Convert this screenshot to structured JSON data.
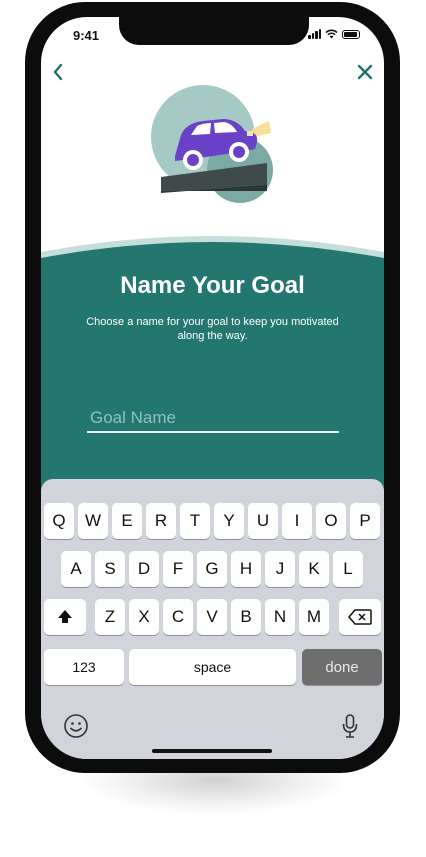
{
  "status_bar": {
    "time": "9:41"
  },
  "nav": {
    "back_icon": "chevron-left-icon",
    "close_icon": "close-icon"
  },
  "colors": {
    "teal": "#24776f",
    "teal_light": "#a5c9c4",
    "car": "#6a42c8"
  },
  "illustration": {
    "name": "car-on-ramp-illustration"
  },
  "header": {
    "title": "Name Your Goal",
    "subtitle": "Choose a name for your goal to keep you motivated along the way."
  },
  "goal_field": {
    "placeholder": "Goal Name",
    "value": ""
  },
  "keyboard": {
    "row1": [
      "Q",
      "W",
      "E",
      "R",
      "T",
      "Y",
      "U",
      "I",
      "O",
      "P"
    ],
    "row2": [
      "A",
      "S",
      "D",
      "F",
      "G",
      "H",
      "J",
      "K",
      "L"
    ],
    "row3": [
      "Z",
      "X",
      "C",
      "V",
      "B",
      "N",
      "M"
    ],
    "numbers_label": "123",
    "space_label": "space",
    "done_label": "done"
  }
}
